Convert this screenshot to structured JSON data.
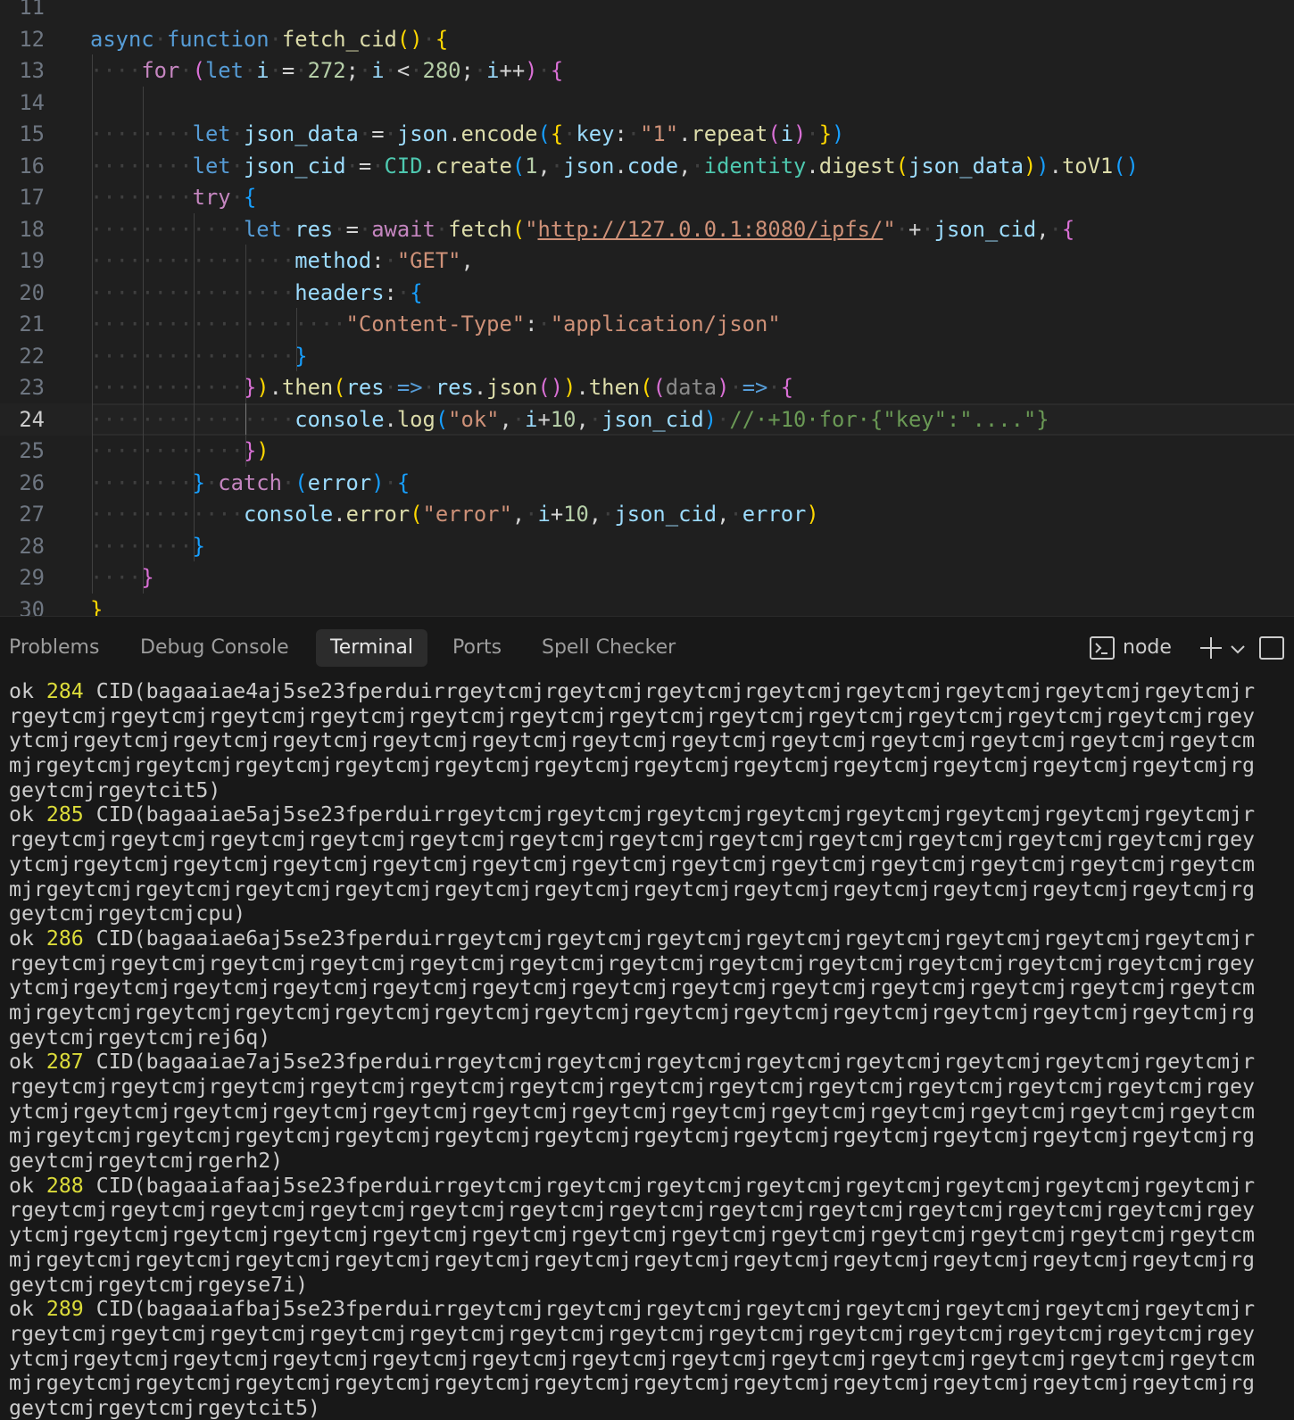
{
  "editor": {
    "lines": [
      {
        "n": "11",
        "segs": []
      },
      {
        "n": "12",
        "segs": [
          [
            "k",
            "async"
          ],
          [
            "ws",
            "·"
          ],
          [
            "k",
            "function"
          ],
          [
            "ws",
            "·"
          ],
          [
            "fn",
            "fetch_cid"
          ],
          [
            "p1",
            "()"
          ],
          [
            "ws",
            "·"
          ],
          [
            "p1",
            "{"
          ]
        ]
      },
      {
        "n": "13",
        "segs": [
          [
            "ws",
            "····"
          ],
          [
            "kc",
            "for"
          ],
          [
            "ws",
            "·"
          ],
          [
            "p2",
            "("
          ],
          [
            "k",
            "let"
          ],
          [
            "ws",
            "·"
          ],
          [
            "v",
            "i"
          ],
          [
            "ws",
            "·"
          ],
          [
            "op",
            "="
          ],
          [
            "ws",
            "·"
          ],
          [
            "num",
            "272"
          ],
          [
            "op",
            ";"
          ],
          [
            "ws",
            "·"
          ],
          [
            "v",
            "i"
          ],
          [
            "ws",
            "·"
          ],
          [
            "op",
            "<"
          ],
          [
            "ws",
            "·"
          ],
          [
            "num",
            "280"
          ],
          [
            "op",
            ";"
          ],
          [
            "ws",
            "·"
          ],
          [
            "v",
            "i"
          ],
          [
            "op",
            "++"
          ],
          [
            "p2",
            ")"
          ],
          [
            "ws",
            "·"
          ],
          [
            "p2",
            "{"
          ]
        ]
      },
      {
        "n": "14",
        "segs": []
      },
      {
        "n": "15",
        "segs": [
          [
            "ws",
            "········"
          ],
          [
            "k",
            "let"
          ],
          [
            "ws",
            "·"
          ],
          [
            "v",
            "json_data"
          ],
          [
            "ws",
            "·"
          ],
          [
            "op",
            "="
          ],
          [
            "ws",
            "·"
          ],
          [
            "v",
            "json"
          ],
          [
            "op",
            "."
          ],
          [
            "fn",
            "encode"
          ],
          [
            "p3",
            "("
          ],
          [
            "p1",
            "{"
          ],
          [
            "ws",
            "·"
          ],
          [
            "v",
            "key"
          ],
          [
            "op",
            ":"
          ],
          [
            "ws",
            "·"
          ],
          [
            "str",
            "\"1\""
          ],
          [
            "op",
            "."
          ],
          [
            "fn",
            "repeat"
          ],
          [
            "p2",
            "("
          ],
          [
            "v",
            "i"
          ],
          [
            "p2",
            ")"
          ],
          [
            "ws",
            "·"
          ],
          [
            "p1",
            "}"
          ],
          [
            "p3",
            ")"
          ]
        ]
      },
      {
        "n": "16",
        "segs": [
          [
            "ws",
            "········"
          ],
          [
            "k",
            "let"
          ],
          [
            "ws",
            "·"
          ],
          [
            "v",
            "json_cid"
          ],
          [
            "ws",
            "·"
          ],
          [
            "op",
            "="
          ],
          [
            "ws",
            "·"
          ],
          [
            "cls",
            "CID"
          ],
          [
            "op",
            "."
          ],
          [
            "fn",
            "create"
          ],
          [
            "p3",
            "("
          ],
          [
            "num",
            "1"
          ],
          [
            "op",
            ","
          ],
          [
            "ws",
            "·"
          ],
          [
            "v",
            "json"
          ],
          [
            "op",
            "."
          ],
          [
            "v",
            "code"
          ],
          [
            "op",
            ","
          ],
          [
            "ws",
            "·"
          ],
          [
            "cls",
            "identity"
          ],
          [
            "op",
            "."
          ],
          [
            "fn",
            "digest"
          ],
          [
            "p1",
            "("
          ],
          [
            "v",
            "json_data"
          ],
          [
            "p1",
            ")"
          ],
          [
            "p3",
            ")"
          ],
          [
            "op",
            "."
          ],
          [
            "fn",
            "toV1"
          ],
          [
            "p3",
            "()"
          ]
        ]
      },
      {
        "n": "17",
        "segs": [
          [
            "ws",
            "········"
          ],
          [
            "kc",
            "try"
          ],
          [
            "ws",
            "·"
          ],
          [
            "p3",
            "{"
          ]
        ]
      },
      {
        "n": "18",
        "segs": [
          [
            "ws",
            "············"
          ],
          [
            "k",
            "let"
          ],
          [
            "ws",
            "·"
          ],
          [
            "v",
            "res"
          ],
          [
            "ws",
            "·"
          ],
          [
            "op",
            "="
          ],
          [
            "ws",
            "·"
          ],
          [
            "kc",
            "await"
          ],
          [
            "ws",
            "·"
          ],
          [
            "fn",
            "fetch"
          ],
          [
            "p1",
            "("
          ],
          [
            "str",
            "\""
          ],
          [
            "url",
            "http://127.0.0.1:8080/ipfs/"
          ],
          [
            "str",
            "\""
          ],
          [
            "ws",
            "·"
          ],
          [
            "op",
            "+"
          ],
          [
            "ws",
            "·"
          ],
          [
            "v",
            "json_cid"
          ],
          [
            "op",
            ","
          ],
          [
            "ws",
            "·"
          ],
          [
            "p2",
            "{"
          ]
        ]
      },
      {
        "n": "19",
        "segs": [
          [
            "ws",
            "················"
          ],
          [
            "v",
            "method"
          ],
          [
            "op",
            ":"
          ],
          [
            "ws",
            "·"
          ],
          [
            "str",
            "\"GET\""
          ],
          [
            "op",
            ","
          ]
        ]
      },
      {
        "n": "20",
        "segs": [
          [
            "ws",
            "················"
          ],
          [
            "v",
            "headers"
          ],
          [
            "op",
            ":"
          ],
          [
            "ws",
            "·"
          ],
          [
            "p3",
            "{"
          ]
        ]
      },
      {
        "n": "21",
        "segs": [
          [
            "ws",
            "····················"
          ],
          [
            "str",
            "\"Content-Type\""
          ],
          [
            "op",
            ":"
          ],
          [
            "ws",
            "·"
          ],
          [
            "str",
            "\"application/json\""
          ]
        ]
      },
      {
        "n": "22",
        "segs": [
          [
            "ws",
            "················"
          ],
          [
            "p3",
            "}"
          ]
        ]
      },
      {
        "n": "23",
        "segs": [
          [
            "ws",
            "············"
          ],
          [
            "p2",
            "}"
          ],
          [
            "p1",
            ")"
          ],
          [
            "op",
            "."
          ],
          [
            "fn",
            "then"
          ],
          [
            "p1",
            "("
          ],
          [
            "v",
            "res"
          ],
          [
            "ws",
            "·"
          ],
          [
            "k",
            "=>"
          ],
          [
            "ws",
            "·"
          ],
          [
            "v",
            "res"
          ],
          [
            "op",
            "."
          ],
          [
            "fn",
            "json"
          ],
          [
            "p2",
            "()"
          ],
          [
            "p1",
            ")"
          ],
          [
            "op",
            "."
          ],
          [
            "fn",
            "then"
          ],
          [
            "p1",
            "("
          ],
          [
            "p2",
            "("
          ],
          [
            "dim",
            "data"
          ],
          [
            "p2",
            ")"
          ],
          [
            "ws",
            "·"
          ],
          [
            "k",
            "=>"
          ],
          [
            "ws",
            "·"
          ],
          [
            "p2",
            "{"
          ]
        ]
      },
      {
        "n": "24",
        "segs": [
          [
            "ws",
            "················"
          ],
          [
            "v",
            "console"
          ],
          [
            "op",
            "."
          ],
          [
            "fn",
            "log"
          ],
          [
            "p3",
            "("
          ],
          [
            "str",
            "\"ok\""
          ],
          [
            "op",
            ","
          ],
          [
            "ws",
            "·"
          ],
          [
            "v",
            "i"
          ],
          [
            "op",
            "+"
          ],
          [
            "num",
            "10"
          ],
          [
            "op",
            ","
          ],
          [
            "ws",
            "·"
          ],
          [
            "v",
            "json_cid"
          ],
          [
            "p3",
            ")"
          ],
          [
            "ws",
            "·"
          ],
          [
            "cm",
            "//·+10·for·{\"key\":\"....\"}"
          ]
        ]
      },
      {
        "n": "25",
        "segs": [
          [
            "ws",
            "············"
          ],
          [
            "p2",
            "}"
          ],
          [
            "p1",
            ")"
          ]
        ]
      },
      {
        "n": "26",
        "segs": [
          [
            "ws",
            "········"
          ],
          [
            "p3",
            "}"
          ],
          [
            "ws",
            "·"
          ],
          [
            "kc",
            "catch"
          ],
          [
            "ws",
            "·"
          ],
          [
            "p3",
            "("
          ],
          [
            "v",
            "error"
          ],
          [
            "p3",
            ")"
          ],
          [
            "ws",
            "·"
          ],
          [
            "p3",
            "{"
          ]
        ]
      },
      {
        "n": "27",
        "segs": [
          [
            "ws",
            "············"
          ],
          [
            "v",
            "console"
          ],
          [
            "op",
            "."
          ],
          [
            "fn",
            "error"
          ],
          [
            "p1",
            "("
          ],
          [
            "str",
            "\"error\""
          ],
          [
            "op",
            ","
          ],
          [
            "ws",
            "·"
          ],
          [
            "v",
            "i"
          ],
          [
            "op",
            "+"
          ],
          [
            "num",
            "10"
          ],
          [
            "op",
            ","
          ],
          [
            "ws",
            "·"
          ],
          [
            "v",
            "json_cid"
          ],
          [
            "op",
            ","
          ],
          [
            "ws",
            "·"
          ],
          [
            "v",
            "error"
          ],
          [
            "p1",
            ")"
          ]
        ]
      },
      {
        "n": "28",
        "segs": [
          [
            "ws",
            "········"
          ],
          [
            "p3",
            "}"
          ]
        ]
      },
      {
        "n": "29",
        "segs": [
          [
            "ws",
            "····"
          ],
          [
            "p2",
            "}"
          ]
        ]
      },
      {
        "n": "30",
        "segs": [
          [
            "p1",
            "}"
          ]
        ]
      }
    ]
  },
  "panel": {
    "tabs": [
      "Problems",
      "Debug Console",
      "Terminal",
      "Ports",
      "Spell Checker"
    ],
    "active_tab": "Terminal",
    "shell_label": "node"
  },
  "terminal": {
    "lines": [
      {
        "prefix": "ok ",
        "num": "284",
        "text": " CID(bagaaiae4aj5se23fperduirrgeytcmjrgeytcmjrgeytcmjrgeytcmjrgeytcmjrgeytcmjrgeytcmjrgeytcmjr"
      },
      {
        "prefix": "",
        "num": "",
        "text": "rgeytcmjrgeytcmjrgeytcmjrgeytcmjrgeytcmjrgeytcmjrgeytcmjrgeytcmjrgeytcmjrgeytcmjrgeytcmjrgeytcmjrgey"
      },
      {
        "prefix": "",
        "num": "",
        "text": "ytcmjrgeytcmjrgeytcmjrgeytcmjrgeytcmjrgeytcmjrgeytcmjrgeytcmjrgeytcmjrgeytcmjrgeytcmjrgeytcmjrgeytcm"
      },
      {
        "prefix": "",
        "num": "",
        "text": "mjrgeytcmjrgeytcmjrgeytcmjrgeytcmjrgeytcmjrgeytcmjrgeytcmjrgeytcmjrgeytcmjrgeytcmjrgeytcmjrgeytcmjrg"
      },
      {
        "prefix": "",
        "num": "",
        "text": "geytcmjrgeytcit5)"
      },
      {
        "prefix": "ok ",
        "num": "285",
        "text": " CID(bagaaiae5aj5se23fperduirrgeytcmjrgeytcmjrgeytcmjrgeytcmjrgeytcmjrgeytcmjrgeytcmjrgeytcmjr"
      },
      {
        "prefix": "",
        "num": "",
        "text": "rgeytcmjrgeytcmjrgeytcmjrgeytcmjrgeytcmjrgeytcmjrgeytcmjrgeytcmjrgeytcmjrgeytcmjrgeytcmjrgeytcmjrgey"
      },
      {
        "prefix": "",
        "num": "",
        "text": "ytcmjrgeytcmjrgeytcmjrgeytcmjrgeytcmjrgeytcmjrgeytcmjrgeytcmjrgeytcmjrgeytcmjrgeytcmjrgeytcmjrgeytcm"
      },
      {
        "prefix": "",
        "num": "",
        "text": "mjrgeytcmjrgeytcmjrgeytcmjrgeytcmjrgeytcmjrgeytcmjrgeytcmjrgeytcmjrgeytcmjrgeytcmjrgeytcmjrgeytcmjrg"
      },
      {
        "prefix": "",
        "num": "",
        "text": "geytcmjrgeytcmjcpu)"
      },
      {
        "prefix": "ok ",
        "num": "286",
        "text": " CID(bagaaiae6aj5se23fperduirrgeytcmjrgeytcmjrgeytcmjrgeytcmjrgeytcmjrgeytcmjrgeytcmjrgeytcmjr"
      },
      {
        "prefix": "",
        "num": "",
        "text": "rgeytcmjrgeytcmjrgeytcmjrgeytcmjrgeytcmjrgeytcmjrgeytcmjrgeytcmjrgeytcmjrgeytcmjrgeytcmjrgeytcmjrgey"
      },
      {
        "prefix": "",
        "num": "",
        "text": "ytcmjrgeytcmjrgeytcmjrgeytcmjrgeytcmjrgeytcmjrgeytcmjrgeytcmjrgeytcmjrgeytcmjrgeytcmjrgeytcmjrgeytcm"
      },
      {
        "prefix": "",
        "num": "",
        "text": "mjrgeytcmjrgeytcmjrgeytcmjrgeytcmjrgeytcmjrgeytcmjrgeytcmjrgeytcmjrgeytcmjrgeytcmjrgeytcmjrgeytcmjrg"
      },
      {
        "prefix": "",
        "num": "",
        "text": "geytcmjrgeytcmjrej6q)"
      },
      {
        "prefix": "ok ",
        "num": "287",
        "text": " CID(bagaaiae7aj5se23fperduirrgeytcmjrgeytcmjrgeytcmjrgeytcmjrgeytcmjrgeytcmjrgeytcmjrgeytcmjr"
      },
      {
        "prefix": "",
        "num": "",
        "text": "rgeytcmjrgeytcmjrgeytcmjrgeytcmjrgeytcmjrgeytcmjrgeytcmjrgeytcmjrgeytcmjrgeytcmjrgeytcmjrgeytcmjrgey"
      },
      {
        "prefix": "",
        "num": "",
        "text": "ytcmjrgeytcmjrgeytcmjrgeytcmjrgeytcmjrgeytcmjrgeytcmjrgeytcmjrgeytcmjrgeytcmjrgeytcmjrgeytcmjrgeytcm"
      },
      {
        "prefix": "",
        "num": "",
        "text": "mjrgeytcmjrgeytcmjrgeytcmjrgeytcmjrgeytcmjrgeytcmjrgeytcmjrgeytcmjrgeytcmjrgeytcmjrgeytcmjrgeytcmjrg"
      },
      {
        "prefix": "",
        "num": "",
        "text": "geytcmjrgeytcmjrgerh2)"
      },
      {
        "prefix": "ok ",
        "num": "288",
        "text": " CID(bagaaiafaaj5se23fperduirrgeytcmjrgeytcmjrgeytcmjrgeytcmjrgeytcmjrgeytcmjrgeytcmjrgeytcmjr"
      },
      {
        "prefix": "",
        "num": "",
        "text": "rgeytcmjrgeytcmjrgeytcmjrgeytcmjrgeytcmjrgeytcmjrgeytcmjrgeytcmjrgeytcmjrgeytcmjrgeytcmjrgeytcmjrgey"
      },
      {
        "prefix": "",
        "num": "",
        "text": "ytcmjrgeytcmjrgeytcmjrgeytcmjrgeytcmjrgeytcmjrgeytcmjrgeytcmjrgeytcmjrgeytcmjrgeytcmjrgeytcmjrgeytcm"
      },
      {
        "prefix": "",
        "num": "",
        "text": "mjrgeytcmjrgeytcmjrgeytcmjrgeytcmjrgeytcmjrgeytcmjrgeytcmjrgeytcmjrgeytcmjrgeytcmjrgeytcmjrgeytcmjrg"
      },
      {
        "prefix": "",
        "num": "",
        "text": "geytcmjrgeytcmjrgeyse7i)"
      },
      {
        "prefix": "ok ",
        "num": "289",
        "text": " CID(bagaaiafbaj5se23fperduirrgeytcmjrgeytcmjrgeytcmjrgeytcmjrgeytcmjrgeytcmjrgeytcmjrgeytcmjr"
      },
      {
        "prefix": "",
        "num": "",
        "text": "rgeytcmjrgeytcmjrgeytcmjrgeytcmjrgeytcmjrgeytcmjrgeytcmjrgeytcmjrgeytcmjrgeytcmjrgeytcmjrgeytcmjrgey"
      },
      {
        "prefix": "",
        "num": "",
        "text": "ytcmjrgeytcmjrgeytcmjrgeytcmjrgeytcmjrgeytcmjrgeytcmjrgeytcmjrgeytcmjrgeytcmjrgeytcmjrgeytcmjrgeytcm"
      },
      {
        "prefix": "",
        "num": "",
        "text": "mjrgeytcmjrgeytcmjrgeytcmjrgeytcmjrgeytcmjrgeytcmjrgeytcmjrgeytcmjrgeytcmjrgeytcmjrgeytcmjrgeytcmjrg"
      },
      {
        "prefix": "",
        "num": "",
        "text": "geytcmjrgeytcmjrgeytcit5)"
      }
    ]
  }
}
